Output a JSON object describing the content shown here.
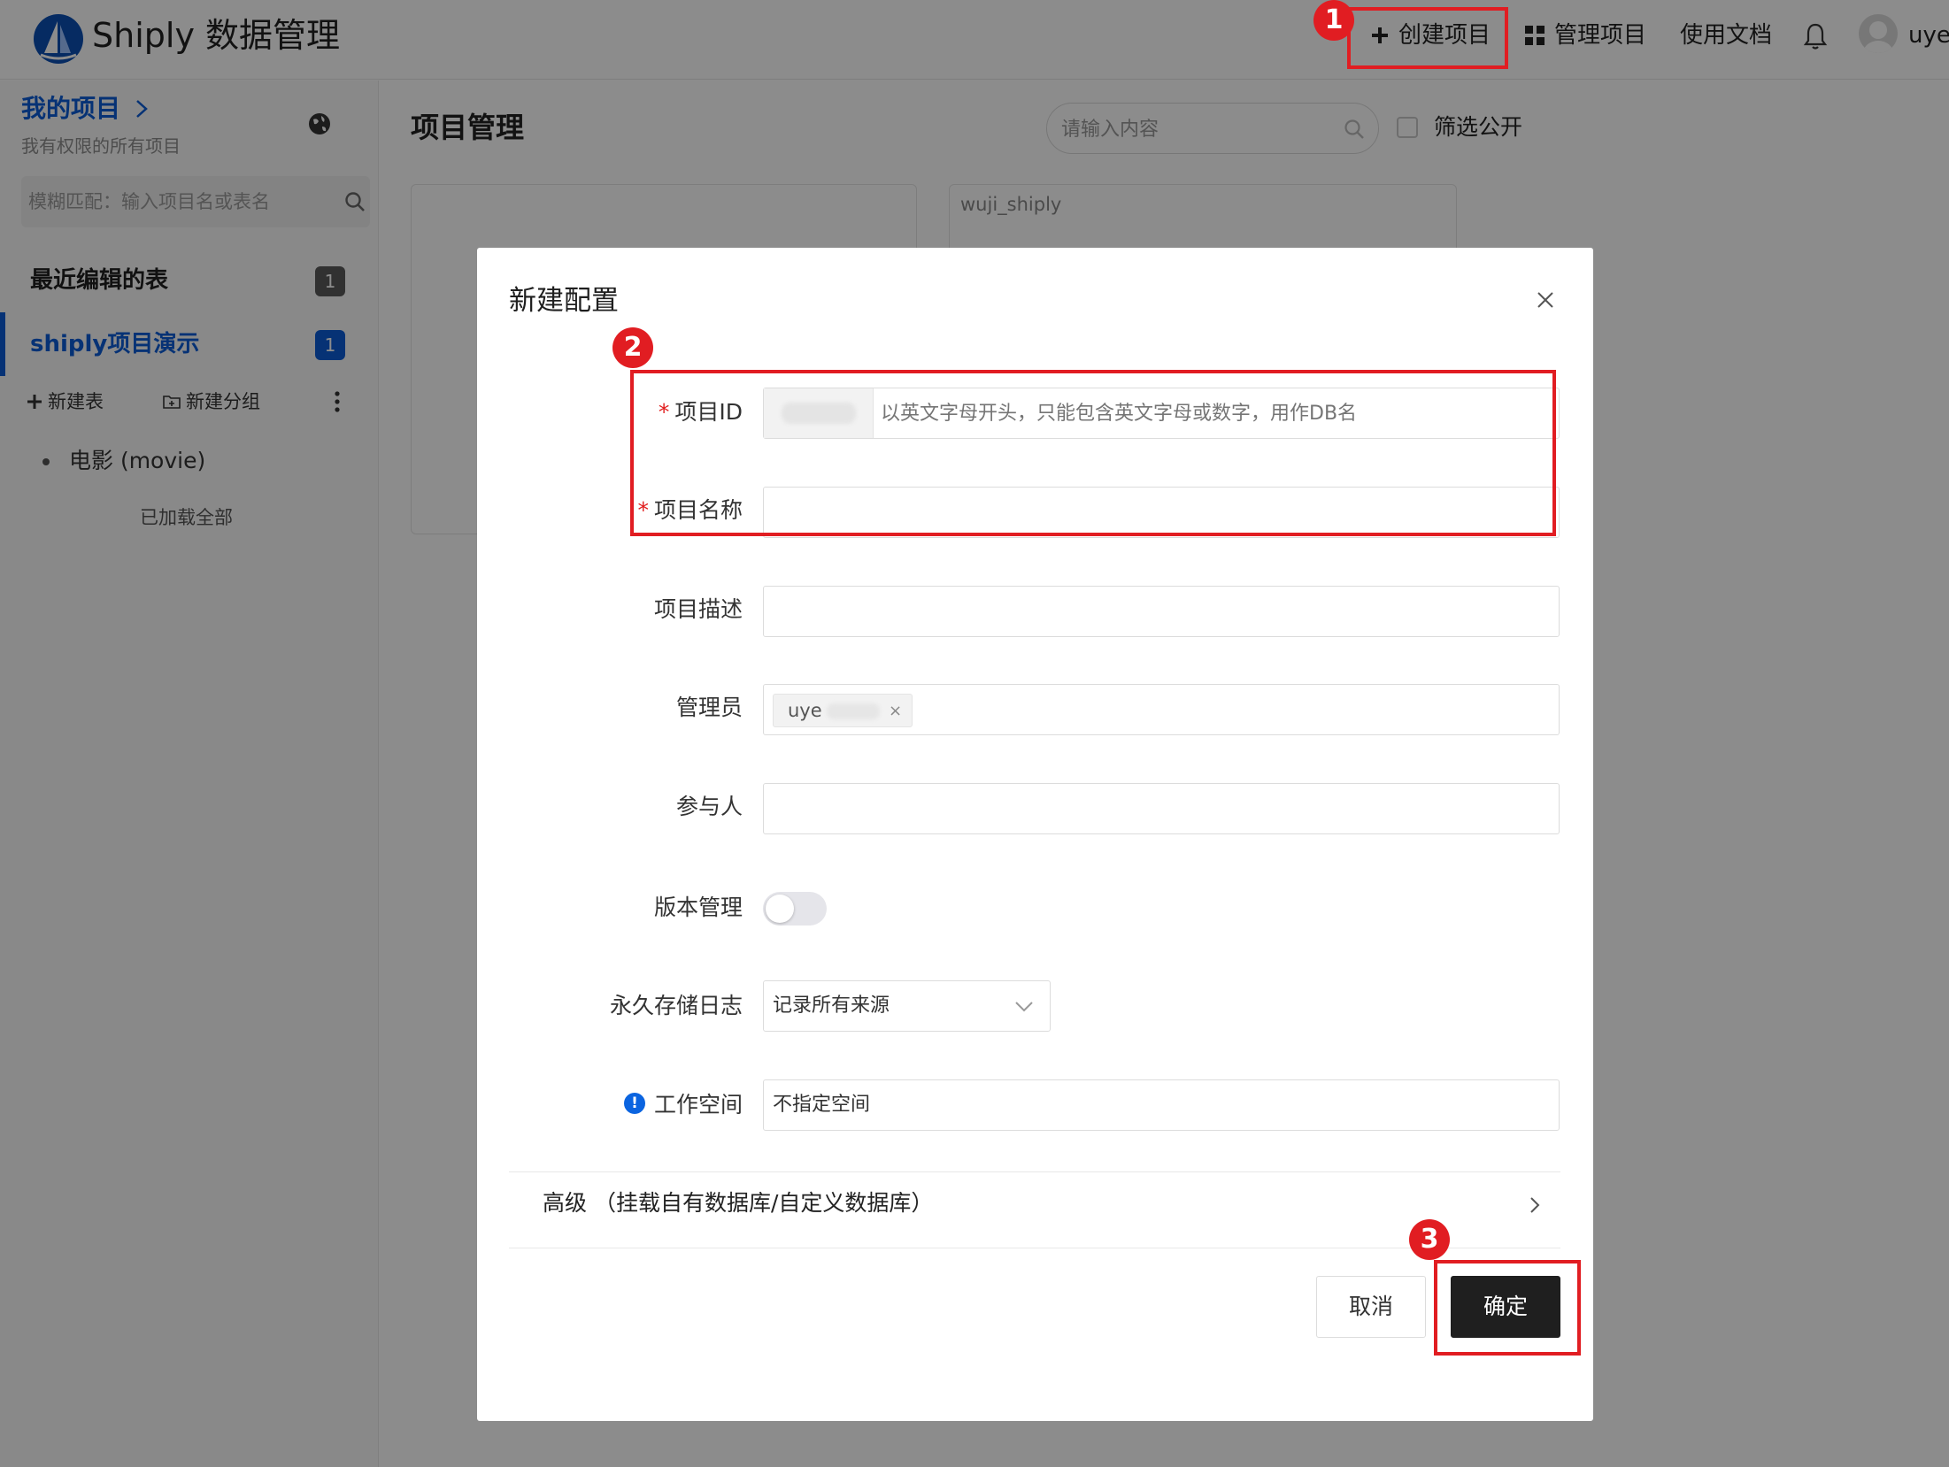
{
  "header": {
    "brand": "Shiply 数据管理",
    "nav": {
      "create": "创建项目",
      "manage": "管理项目",
      "docs": "使用文档"
    },
    "username": "uye"
  },
  "sidebar": {
    "title": "我的项目",
    "subtitle": "我有权限的所有项目",
    "search_placeholder": "模糊匹配：输入项目名或表名",
    "recent": {
      "label": "最近编辑的表",
      "count": "1"
    },
    "project": {
      "label": "shiply项目演示",
      "count": "1"
    },
    "actions": {
      "new_table": "新建表",
      "new_group": "新建分组"
    },
    "items": [
      {
        "label": "电影 (movie)"
      }
    ],
    "loaded_all": "已加载全部"
  },
  "main": {
    "title": "项目管理",
    "search_placeholder": "请输入内容",
    "filter_public": "筛选公开",
    "cards": [
      {
        "title": ""
      },
      {
        "title": "wuji_shiply"
      }
    ]
  },
  "modal": {
    "title": "新建配置",
    "fields": {
      "project_id": {
        "label": "项目ID",
        "placeholder": "以英文字母开头，只能包含英文字母或数字，用作DB名"
      },
      "project_name": {
        "label": "项目名称"
      },
      "description": {
        "label": "项目描述"
      },
      "admins": {
        "label": "管理员",
        "tag": "uye",
        "tag_remove": "×"
      },
      "participants": {
        "label": "参与人"
      },
      "versioning": {
        "label": "版本管理",
        "enabled": false
      },
      "log_storage": {
        "label": "永久存储日志",
        "value": "记录所有来源"
      },
      "workspace": {
        "label": "工作空间",
        "value": "不指定空间",
        "info_icon": "!"
      }
    },
    "advanced": "高级 （挂载自有数据库/自定义数据库）",
    "buttons": {
      "cancel": "取消",
      "ok": "确定"
    }
  },
  "annotations": {
    "markers": [
      "1",
      "2",
      "3"
    ],
    "color": "#e11d22"
  },
  "colors": {
    "accent": "#0b5cd6",
    "primary_button": "#1f1f1f",
    "required": "#e11d1d"
  }
}
